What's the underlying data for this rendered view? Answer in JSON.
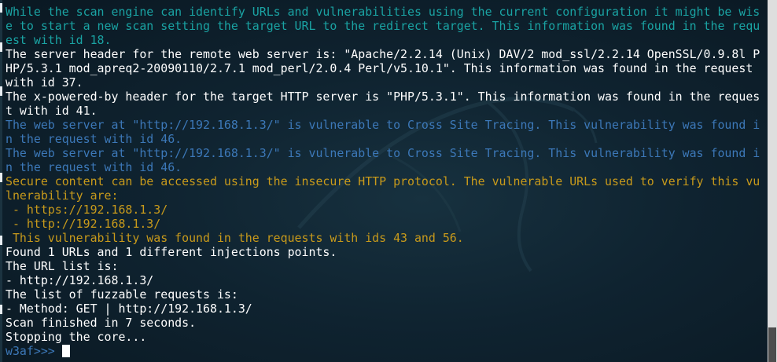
{
  "terminal": {
    "lines": [
      {
        "text": "While the scan engine can identify URLs and vulnerabilities using the current configuration it might be wis",
        "color": "#1aa3a3"
      },
      {
        "text": "e to start a new scan setting the target URL to the redirect target. This information was found in the requ",
        "color": "#1aa3a3"
      },
      {
        "text": "est with id 18.",
        "color": "#1aa3a3"
      },
      {
        "text": "The server header for the remote web server is: \"Apache/2.2.14 (Unix) DAV/2 mod_ssl/2.2.14 OpenSSL/0.9.8l P",
        "color": "#ffffff"
      },
      {
        "text": "HP/5.3.1 mod_apreq2-20090110/2.7.1 mod_perl/2.0.4 Perl/v5.10.1\". This information was found in the request",
        "color": "#ffffff"
      },
      {
        "text": "with id 37.",
        "color": "#ffffff"
      },
      {
        "text": "The x-powered-by header for the target HTTP server is \"PHP/5.3.1\". This information was found in the reques",
        "color": "#ffffff"
      },
      {
        "text": "t with id 41.",
        "color": "#ffffff"
      },
      {
        "text": "The web server at \"http://192.168.1.3/\" is vulnerable to Cross Site Tracing. This vulnerability was found i",
        "color": "#3c78b8"
      },
      {
        "text": "n the request with id 46.",
        "color": "#3c78b8"
      },
      {
        "text": "The web server at \"http://192.168.1.3/\" is vulnerable to Cross Site Tracing. This vulnerability was found i",
        "color": "#3c78b8"
      },
      {
        "text": "n the request with id 46.",
        "color": "#3c78b8"
      },
      {
        "text": "Secure content can be accessed using the insecure HTTP protocol. The vulnerable URLs used to verify this vu",
        "color": "#c89a1b"
      },
      {
        "text": "lnerability are:",
        "color": "#c89a1b"
      },
      {
        "text": " - https://192.168.1.3/",
        "color": "#c89a1b"
      },
      {
        "text": " - http://192.168.1.3/",
        "color": "#c89a1b"
      },
      {
        "text": " This vulnerability was found in the requests with ids 43 and 56.",
        "color": "#c89a1b"
      },
      {
        "text": "Found 1 URLs and 1 different injections points.",
        "color": "#ffffff"
      },
      {
        "text": "The URL list is:",
        "color": "#ffffff"
      },
      {
        "text": "- http://192.168.1.3/",
        "color": "#ffffff"
      },
      {
        "text": "The list of fuzzable requests is:",
        "color": "#ffffff"
      },
      {
        "text": "- Method: GET | http://192.168.1.3/",
        "color": "#ffffff"
      },
      {
        "text": "Scan finished in 7 seconds.",
        "color": "#ffffff"
      },
      {
        "text": "Stopping the core...",
        "color": "#ffffff"
      }
    ],
    "prompt": "w3af>>>",
    "prompt_color": "#3c78b8",
    "background": "#0f2330"
  },
  "scrollbar": {
    "position_fraction": 1.0
  }
}
